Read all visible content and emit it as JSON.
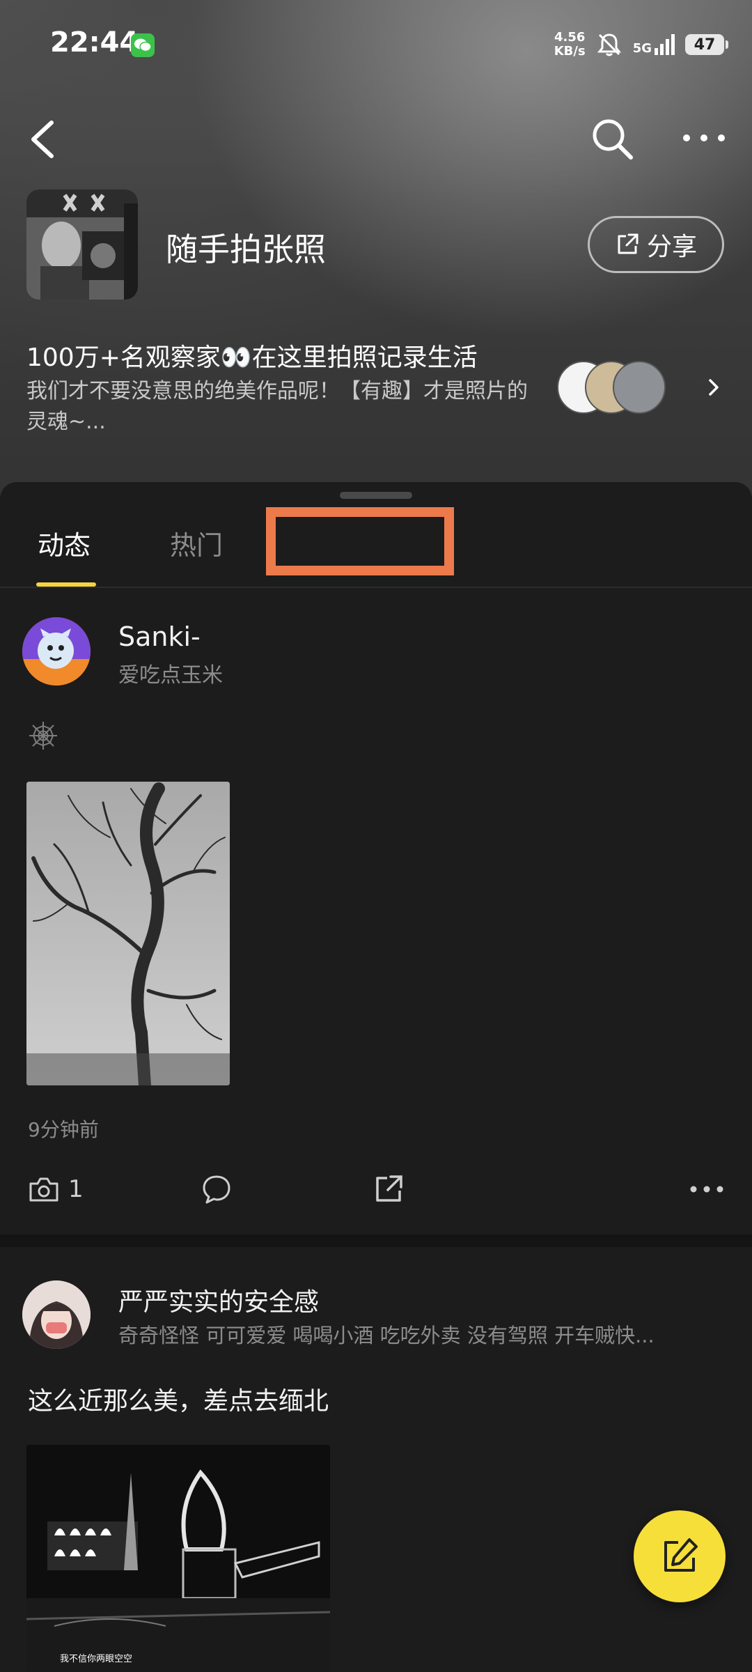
{
  "status_bar": {
    "time": "22:44",
    "net_speed_value": "4.56",
    "net_speed_unit": "KB/s",
    "network": "5G",
    "battery": "47",
    "icons": [
      "wechat-icon",
      "mute-icon",
      "signal-icon",
      "battery-icon"
    ]
  },
  "nav": {
    "icons": [
      "back-icon",
      "search-icon",
      "more-icon"
    ]
  },
  "group": {
    "name": "随手拍张照",
    "share_label": "分享",
    "headline": "100万+名观察家👀在这里拍照记录生活",
    "description": "我们才不要没意思的绝美作品呢！【有趣】才是照片的灵魂~..."
  },
  "tabs": [
    {
      "label": "动态",
      "active": true
    },
    {
      "label": "热门",
      "active": false
    }
  ],
  "posts": [
    {
      "username": "Sanki-",
      "subtitle": "爱吃点玉米",
      "time_ago": "9分钟前",
      "photo_count": "1"
    },
    {
      "username": "严严实实的安全感",
      "subtitle": "奇奇怪怪 可可爱爱  喝喝小酒 吃吃外卖  没有驾照 开车贼快...",
      "text": "这么近那么美，差点去缅北",
      "image_caption": "我不信你两眼空空"
    }
  ],
  "colors": {
    "accent": "#f5d442",
    "highlight": "#ec7a4a",
    "background": "#1c1c1c"
  }
}
